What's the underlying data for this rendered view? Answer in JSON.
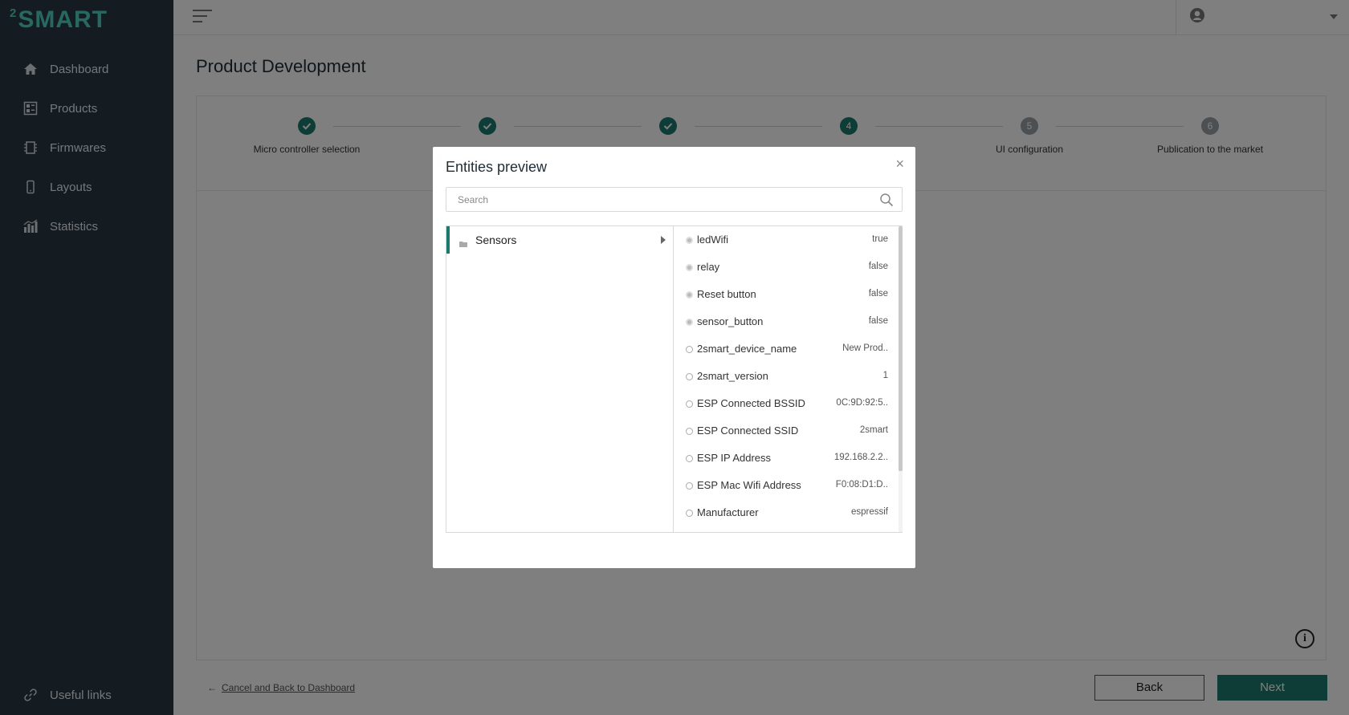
{
  "app": {
    "logo_sup": "2",
    "logo_text": "SMART"
  },
  "sidebar": {
    "items": [
      {
        "label": "Dashboard",
        "icon": "home-icon"
      },
      {
        "label": "Products",
        "icon": "products-icon"
      },
      {
        "label": "Firmwares",
        "icon": "firmware-icon"
      },
      {
        "label": "Layouts",
        "icon": "phone-icon"
      },
      {
        "label": "Statistics",
        "icon": "statistics-icon"
      }
    ],
    "footer": {
      "label": "Useful links",
      "icon": "link-icon"
    }
  },
  "page": {
    "title": "Product Development"
  },
  "stepper": {
    "steps": [
      {
        "label": "Micro controller selection",
        "state": "done",
        "number": "1"
      },
      {
        "label": "",
        "state": "done",
        "number": "2"
      },
      {
        "label": "",
        "state": "done",
        "number": "3"
      },
      {
        "label": "",
        "state": "active",
        "number": "4"
      },
      {
        "label": "UI configuration",
        "state": "pending",
        "number": "5"
      },
      {
        "label": "Publication to the market",
        "state": "pending",
        "number": "6"
      }
    ]
  },
  "footer": {
    "cancel_arrow": "←",
    "cancel_label": "Cancel and Back to Dashboard",
    "back_label": "Back",
    "next_label": "Next",
    "info_label": "i"
  },
  "modal": {
    "title": "Entities preview",
    "close_label": "×",
    "search": {
      "placeholder": "Search",
      "value": ""
    },
    "groups": [
      {
        "label": "Sensors",
        "selected": true
      }
    ],
    "entities": [
      {
        "name": "ledWifi",
        "value": "true",
        "kind": "sensor"
      },
      {
        "name": "relay",
        "value": "false",
        "kind": "sensor"
      },
      {
        "name": "Reset button",
        "value": "false",
        "kind": "sensor"
      },
      {
        "name": "sensor_button",
        "value": "false",
        "kind": "sensor"
      },
      {
        "name": "2smart_device_name",
        "value": "New Prod..",
        "kind": "attr"
      },
      {
        "name": "2smart_version",
        "value": "1",
        "kind": "attr"
      },
      {
        "name": "ESP Connected BSSID",
        "value": "0C:9D:92:5..",
        "kind": "attr"
      },
      {
        "name": "ESP Connected SSID",
        "value": "2smart",
        "kind": "attr"
      },
      {
        "name": "ESP IP Address",
        "value": "192.168.2.2..",
        "kind": "attr"
      },
      {
        "name": "ESP Mac Wifi Address",
        "value": "F0:08:D1:D..",
        "kind": "attr"
      },
      {
        "name": "Manufacturer",
        "value": "espressif",
        "kind": "attr"
      }
    ]
  },
  "colors": {
    "accent": "#1b7a6c",
    "sidebar_bg": "#283845",
    "logo": "#4fd1c1"
  }
}
